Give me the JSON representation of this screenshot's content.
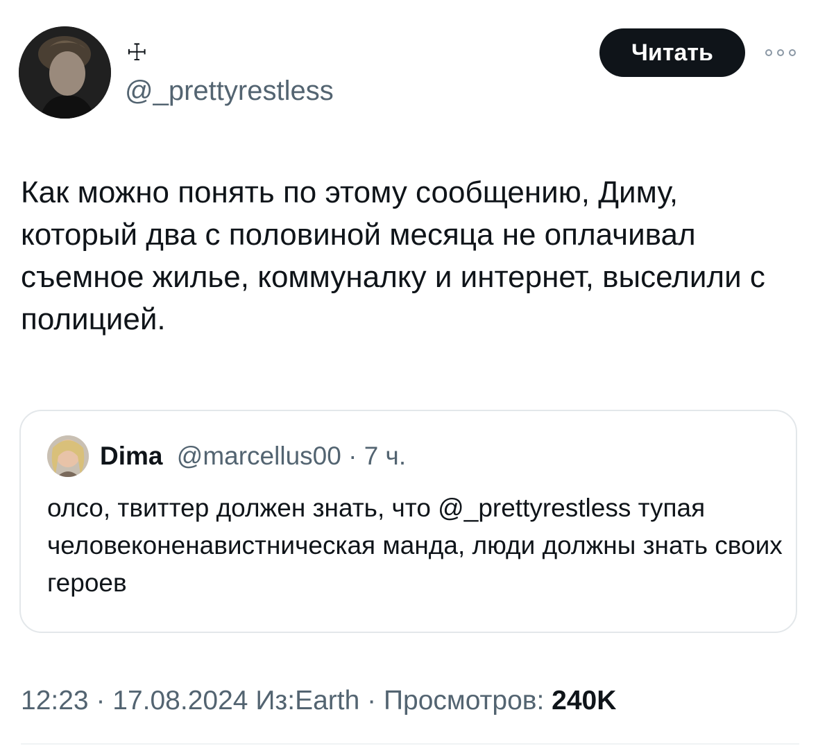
{
  "author": {
    "display_name": "☩",
    "handle": "@_prettyrestless"
  },
  "follow_button": {
    "label": "Читать"
  },
  "more_icon": "more-horizontal-icon",
  "tweet": {
    "text": "Как можно понять по этому сообщению, Диму, который два с половиной месяца не оплачивал съемное жилье, коммуналку и интернет, выселили с полицией."
  },
  "quote": {
    "name": "Dima",
    "handle": "@marcellus00",
    "separator": " · ",
    "time": "7 ч.",
    "text": "олсо, твиттер должен знать, что @_prettyrestless тупая человеконенавистническая манда, люди должны знать своих героев"
  },
  "meta": {
    "time": "12:23",
    "sep1": " · ",
    "date": "17.08.2024",
    "source": " Из:Earth",
    "sep2": " · ",
    "views_label": "Просмотров: ",
    "views_count": "240K"
  },
  "colors": {
    "text": "#0f1419",
    "secondary": "#536471",
    "border": "#e3e7ea",
    "button_bg": "#0f1419"
  }
}
